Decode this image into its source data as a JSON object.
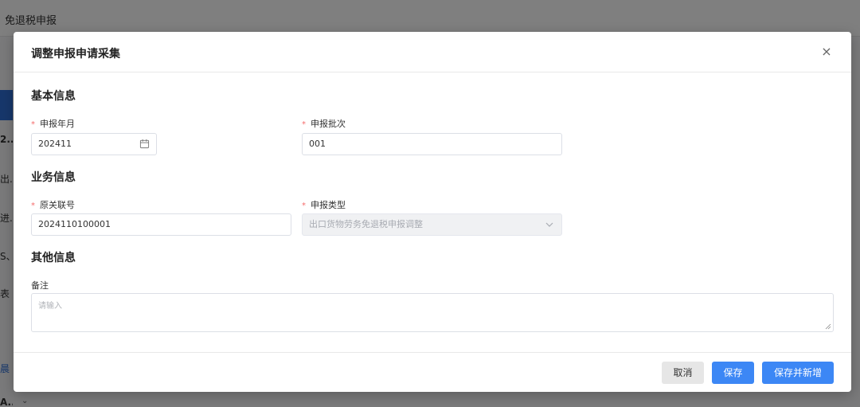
{
  "background": {
    "page_title": "免退税申报",
    "side_fragments": [
      "2...",
      "出...",
      "进...",
      "S、...",
      "表",
      "晨",
      "A..."
    ]
  },
  "modal": {
    "title": "调整申报申请采集",
    "close_icon": "close-icon",
    "sections": {
      "basic": "基本信息",
      "business": "业务信息",
      "other": "其他信息"
    },
    "fields": {
      "report_month": {
        "label": "申报年月",
        "required": "*",
        "value": "202411",
        "icon": "calendar-icon"
      },
      "report_batch": {
        "label": "申报批次",
        "required": "*",
        "value": "001"
      },
      "original_customs_no": {
        "label": "原关联号",
        "required": "*",
        "value": "2024110100001"
      },
      "report_type": {
        "label": "申报类型",
        "required": "*",
        "value": "出口货物劳务免退税申报调整",
        "disabled": true,
        "icon": "chevron-down-icon"
      },
      "remark": {
        "label": "备注",
        "placeholder": "请输入"
      }
    },
    "buttons": {
      "cancel": "取消",
      "save": "保存",
      "save_and_new": "保存并新增"
    }
  },
  "colors": {
    "primary": "#3c87f5",
    "required": "#f56c6c",
    "overlay": "rgba(0,0,0,0.5)"
  }
}
